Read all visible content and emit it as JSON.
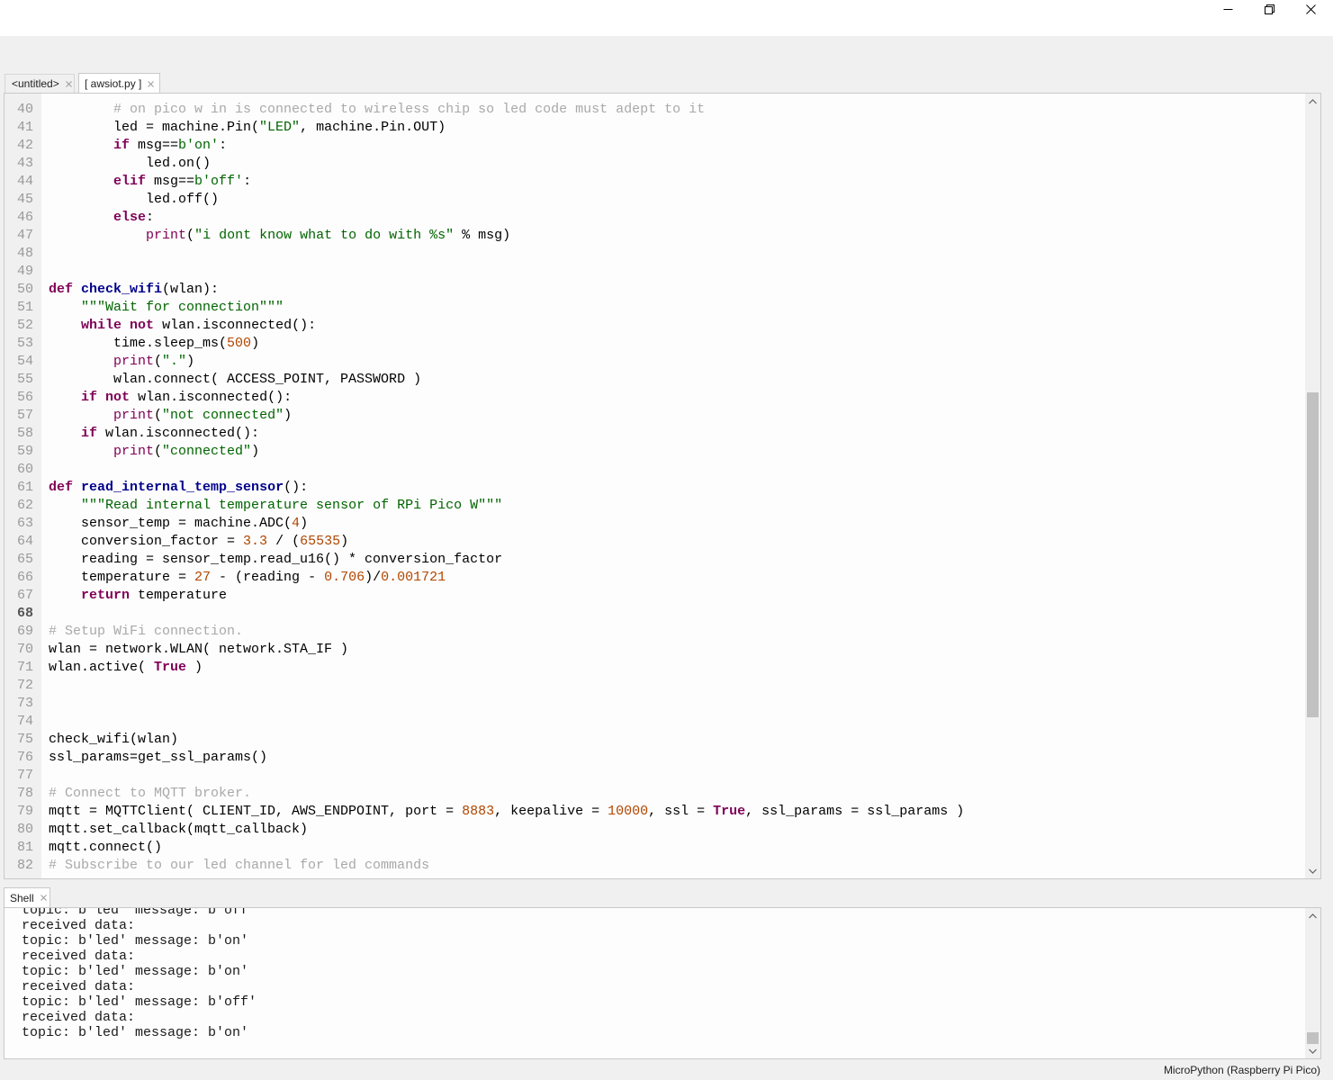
{
  "window_controls": [
    "minimize-icon",
    "restore-icon",
    "close-icon"
  ],
  "editor_tabs": [
    {
      "label": "<untitled>",
      "active": false,
      "close_icon": "close-icon"
    },
    {
      "label": "[ awsiot.py ]",
      "active": true,
      "close_icon": "close-icon"
    }
  ],
  "syntax_colors": {
    "keyword": "#7f0055",
    "builtin": "#7f0055",
    "definition": "#00008b",
    "string": "#006400",
    "number": "#b04600",
    "comment": "#a9a9a9"
  },
  "editor": {
    "current_line": 68,
    "lines": [
      {
        "n": 40,
        "tokens": [
          [
            "        ",
            ""
          ],
          [
            "# on pico w in is connected to wireless chip so led code must adept to it",
            "comment"
          ]
        ]
      },
      {
        "n": 41,
        "tokens": [
          [
            "        led = machine.Pin(",
            ""
          ],
          [
            "\"LED\"",
            "string"
          ],
          [
            ", machine.Pin.OUT)",
            ""
          ]
        ]
      },
      {
        "n": 42,
        "tokens": [
          [
            "        ",
            ""
          ],
          [
            "if",
            "keyword"
          ],
          [
            " msg==",
            ""
          ],
          [
            "b'on'",
            "string"
          ],
          [
            ":",
            ""
          ]
        ]
      },
      {
        "n": 43,
        "tokens": [
          [
            "            led.on()",
            ""
          ]
        ]
      },
      {
        "n": 44,
        "tokens": [
          [
            "        ",
            ""
          ],
          [
            "elif",
            "keyword"
          ],
          [
            " msg==",
            ""
          ],
          [
            "b'off'",
            "string"
          ],
          [
            ":",
            ""
          ]
        ]
      },
      {
        "n": 45,
        "tokens": [
          [
            "            led.off()",
            ""
          ]
        ]
      },
      {
        "n": 46,
        "tokens": [
          [
            "        ",
            ""
          ],
          [
            "else",
            "keyword"
          ],
          [
            ":",
            ""
          ]
        ]
      },
      {
        "n": 47,
        "tokens": [
          [
            "            ",
            ""
          ],
          [
            "print",
            "builtin"
          ],
          [
            "(",
            ""
          ],
          [
            "\"i dont know what to do with %s\"",
            "string"
          ],
          [
            " % msg)",
            ""
          ]
        ]
      },
      {
        "n": 48,
        "tokens": []
      },
      {
        "n": 49,
        "tokens": []
      },
      {
        "n": 50,
        "tokens": [
          [
            "def",
            "keyword"
          ],
          [
            " ",
            ""
          ],
          [
            "check_wifi",
            "definition"
          ],
          [
            "(wlan):",
            ""
          ]
        ]
      },
      {
        "n": 51,
        "tokens": [
          [
            "    ",
            ""
          ],
          [
            "\"\"\"Wait for connection\"\"\"",
            "string"
          ]
        ]
      },
      {
        "n": 52,
        "tokens": [
          [
            "    ",
            ""
          ],
          [
            "while",
            "keyword"
          ],
          [
            " ",
            ""
          ],
          [
            "not",
            "keyword"
          ],
          [
            " wlan.isconnected():",
            ""
          ]
        ]
      },
      {
        "n": 53,
        "tokens": [
          [
            "        time.sleep_ms(",
            ""
          ],
          [
            "500",
            "number"
          ],
          [
            ")",
            ""
          ]
        ]
      },
      {
        "n": 54,
        "tokens": [
          [
            "        ",
            ""
          ],
          [
            "print",
            "builtin"
          ],
          [
            "(",
            ""
          ],
          [
            "\".\"",
            "string"
          ],
          [
            ")",
            ""
          ]
        ]
      },
      {
        "n": 55,
        "tokens": [
          [
            "        wlan.connect( ACCESS_POINT, PASSWORD )",
            ""
          ]
        ]
      },
      {
        "n": 56,
        "tokens": [
          [
            "    ",
            ""
          ],
          [
            "if",
            "keyword"
          ],
          [
            " ",
            ""
          ],
          [
            "not",
            "keyword"
          ],
          [
            " wlan.isconnected():",
            ""
          ]
        ]
      },
      {
        "n": 57,
        "tokens": [
          [
            "        ",
            ""
          ],
          [
            "print",
            "builtin"
          ],
          [
            "(",
            ""
          ],
          [
            "\"not connected\"",
            "string"
          ],
          [
            ")",
            ""
          ]
        ]
      },
      {
        "n": 58,
        "tokens": [
          [
            "    ",
            ""
          ],
          [
            "if",
            "keyword"
          ],
          [
            " wlan.isconnected():",
            ""
          ]
        ]
      },
      {
        "n": 59,
        "tokens": [
          [
            "        ",
            ""
          ],
          [
            "print",
            "builtin"
          ],
          [
            "(",
            ""
          ],
          [
            "\"connected\"",
            "string"
          ],
          [
            ")",
            ""
          ]
        ]
      },
      {
        "n": 60,
        "tokens": []
      },
      {
        "n": 61,
        "tokens": [
          [
            "def",
            "keyword"
          ],
          [
            " ",
            ""
          ],
          [
            "read_internal_temp_sensor",
            "definition"
          ],
          [
            "():",
            ""
          ]
        ]
      },
      {
        "n": 62,
        "tokens": [
          [
            "    ",
            ""
          ],
          [
            "\"\"\"Read internal temperature sensor of RPi Pico W\"\"\"",
            "string"
          ]
        ]
      },
      {
        "n": 63,
        "tokens": [
          [
            "    sensor_temp = machine.ADC(",
            ""
          ],
          [
            "4",
            "number"
          ],
          [
            ")",
            ""
          ]
        ]
      },
      {
        "n": 64,
        "tokens": [
          [
            "    conversion_factor = ",
            ""
          ],
          [
            "3.3",
            "number"
          ],
          [
            " / (",
            ""
          ],
          [
            "65535",
            "number"
          ],
          [
            ")",
            ""
          ]
        ]
      },
      {
        "n": 65,
        "tokens": [
          [
            "    reading = sensor_temp.read_u16() * conversion_factor",
            ""
          ]
        ]
      },
      {
        "n": 66,
        "tokens": [
          [
            "    temperature = ",
            ""
          ],
          [
            "27",
            "number"
          ],
          [
            " - (reading - ",
            ""
          ],
          [
            "0.706",
            "number"
          ],
          [
            ")/",
            ""
          ],
          [
            "0.001721",
            "number"
          ]
        ]
      },
      {
        "n": 67,
        "tokens": [
          [
            "    ",
            ""
          ],
          [
            "return",
            "keyword"
          ],
          [
            " temperature",
            ""
          ]
        ]
      },
      {
        "n": 68,
        "tokens": []
      },
      {
        "n": 69,
        "tokens": [
          [
            "# Setup WiFi connection.",
            "comment"
          ]
        ]
      },
      {
        "n": 70,
        "tokens": [
          [
            "wlan = network.WLAN( network.STA_IF )",
            ""
          ]
        ]
      },
      {
        "n": 71,
        "tokens": [
          [
            "wlan.active( ",
            ""
          ],
          [
            "True",
            "keyword"
          ],
          [
            " )",
            ""
          ]
        ]
      },
      {
        "n": 72,
        "tokens": []
      },
      {
        "n": 73,
        "tokens": []
      },
      {
        "n": 74,
        "tokens": []
      },
      {
        "n": 75,
        "tokens": [
          [
            "check_wifi(wlan)",
            ""
          ]
        ]
      },
      {
        "n": 76,
        "tokens": [
          [
            "ssl_params=get_ssl_params()",
            ""
          ]
        ]
      },
      {
        "n": 77,
        "tokens": []
      },
      {
        "n": 78,
        "tokens": [
          [
            "# Connect to MQTT broker.",
            "comment"
          ]
        ]
      },
      {
        "n": 79,
        "tokens": [
          [
            "mqtt = MQTTClient( CLIENT_ID, AWS_ENDPOINT, port = ",
            ""
          ],
          [
            "8883",
            "number"
          ],
          [
            ", keepalive = ",
            ""
          ],
          [
            "10000",
            "number"
          ],
          [
            ", ssl = ",
            ""
          ],
          [
            "True",
            "keyword"
          ],
          [
            ", ssl_params = ssl_params )",
            ""
          ]
        ]
      },
      {
        "n": 80,
        "tokens": [
          [
            "mqtt.set_callback(mqtt_callback)",
            ""
          ]
        ]
      },
      {
        "n": 81,
        "tokens": [
          [
            "mqtt.connect()",
            ""
          ]
        ]
      },
      {
        "n": 82,
        "tokens": [
          [
            "# Subscribe to our led channel for led commands",
            "comment"
          ]
        ]
      }
    ]
  },
  "shell": {
    "tab_label": "Shell",
    "close_icon": "close-icon",
    "lines": [
      "topic: b'led' message: b'off'",
      "received data:",
      "topic: b'led' message: b'on'",
      "received data:",
      "topic: b'led' message: b'on'",
      "received data:",
      "topic: b'led' message: b'off'",
      "received data:",
      "topic: b'led' message: b'on'"
    ]
  },
  "status_bar": {
    "interpreter": "MicroPython (Raspberry Pi Pico)"
  }
}
